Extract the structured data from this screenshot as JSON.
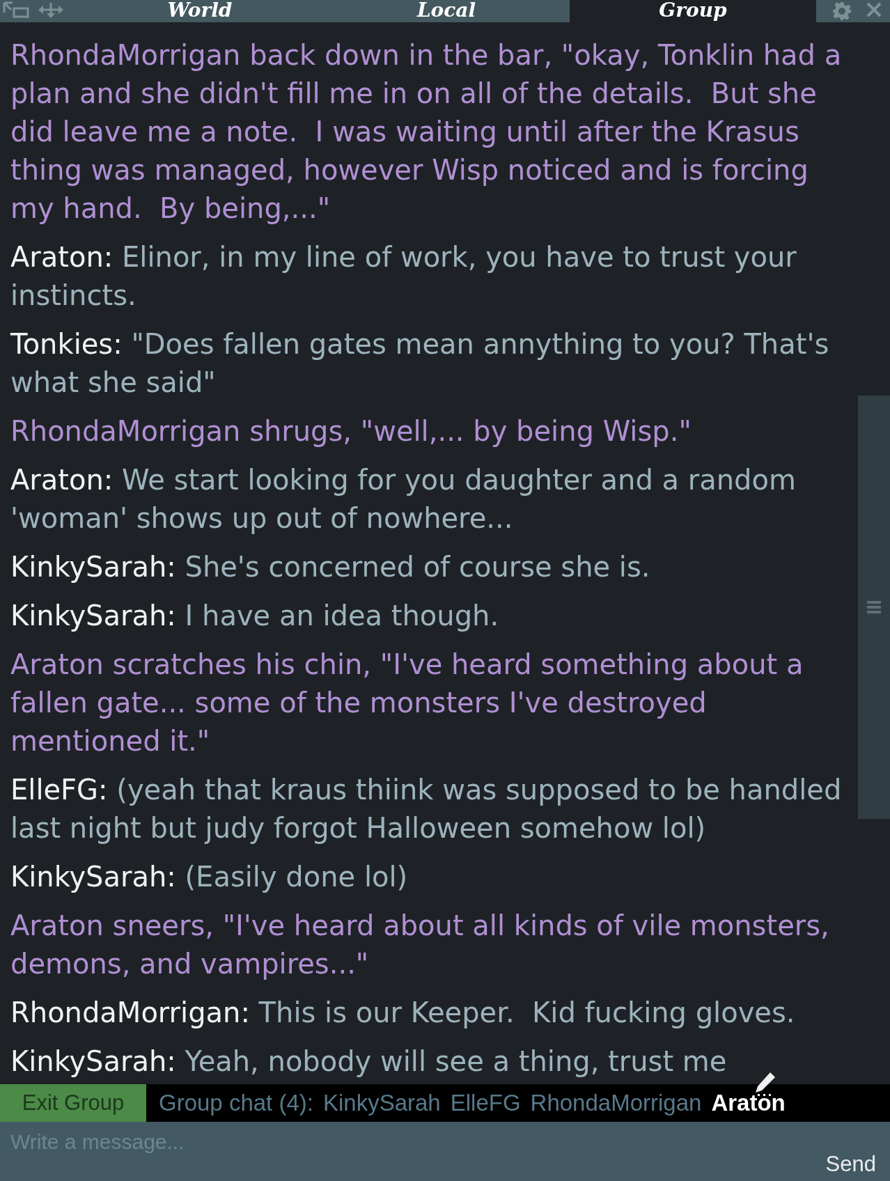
{
  "tabs": [
    {
      "label": "World",
      "selected": false
    },
    {
      "label": "Local",
      "selected": false
    },
    {
      "label": "Group",
      "selected": true
    }
  ],
  "messages": [
    {
      "kind": "emote",
      "text": "RhondaMorrigan back down in the bar, \"okay, Tonklin had a plan and she didn't fill me in on all of the details.  But she did leave me a note.  I was waiting until after the Krasus thing was managed, however Wisp noticed and is forcing my hand.  By being,...\""
    },
    {
      "kind": "say",
      "speaker": "Araton:",
      "text": "Elinor, in my line of work, you have to trust your instincts."
    },
    {
      "kind": "say",
      "speaker": "Tonkies:",
      "text": "\"Does fallen gates mean annything to you? That's what she said\""
    },
    {
      "kind": "emote",
      "text": "RhondaMorrigan shrugs, \"well,... by being Wisp.\""
    },
    {
      "kind": "say",
      "speaker": "Araton:",
      "text": "We start looking for you daughter and a random 'woman' shows up out of nowhere..."
    },
    {
      "kind": "say",
      "speaker": "KinkySarah:",
      "text": "She's concerned of course she is."
    },
    {
      "kind": "say",
      "speaker": "KinkySarah:",
      "text": "I have an idea though."
    },
    {
      "kind": "emote",
      "text": "Araton scratches his chin, \"I've heard something about a fallen gate... some of the monsters I've destroyed mentioned it.\""
    },
    {
      "kind": "say",
      "speaker": "ElleFG:",
      "text": "(yeah that kraus thiink was supposed to be handled last night but judy forgot Halloween somehow lol)"
    },
    {
      "kind": "say",
      "speaker": "KinkySarah:",
      "text": "(Easily done lol)"
    },
    {
      "kind": "emote",
      "text": "Araton sneers, \"I've heard about all kinds of vile monsters, demons, and vampires...\""
    },
    {
      "kind": "say",
      "speaker": "RhondaMorrigan:",
      "text": "This is our Keeper.  Kid fucking gloves."
    },
    {
      "kind": "say",
      "speaker": "KinkySarah:",
      "text": "Yeah, nobody will see a thing, trust me"
    }
  ],
  "group_bar": {
    "exit_button": "Exit Group",
    "label": "Group chat (4):",
    "members": [
      {
        "name": "KinkySarah",
        "highlighted": false
      },
      {
        "name": "ElleFG",
        "highlighted": false
      },
      {
        "name": "RhondaMorrigan",
        "highlighted": false
      },
      {
        "name": "Araton",
        "highlighted": true
      }
    ]
  },
  "composer": {
    "placeholder": "Write a message...",
    "send_button": "Send"
  }
}
